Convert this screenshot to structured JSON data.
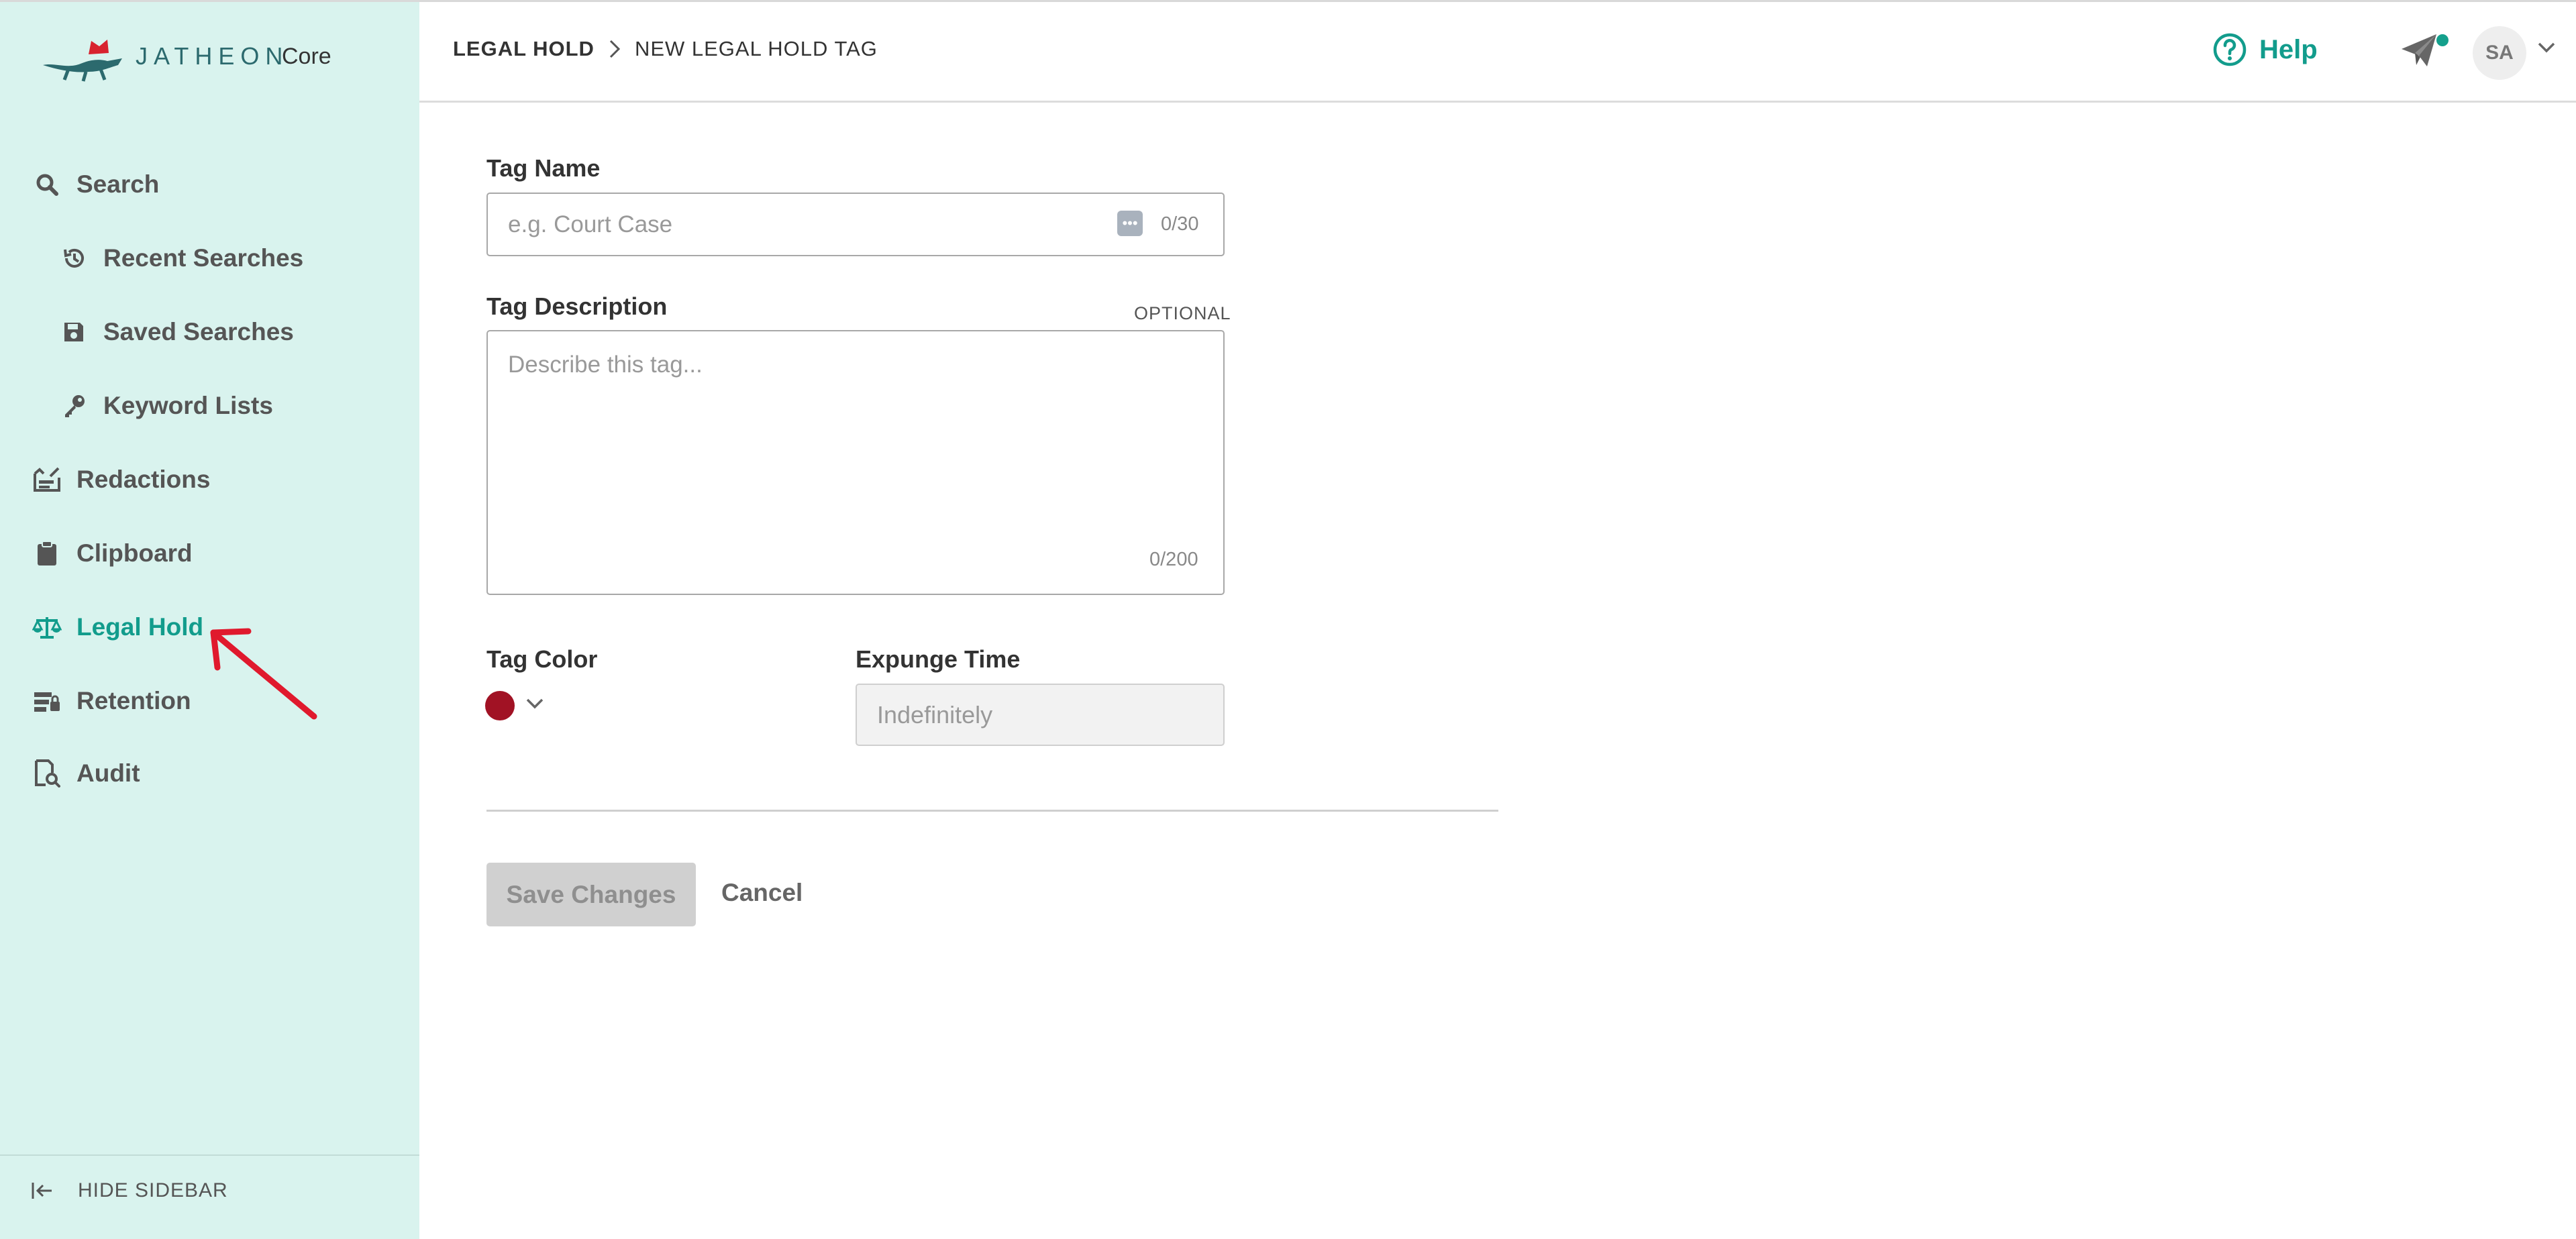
{
  "logo": {
    "brand": "JATHEON",
    "product": "Core"
  },
  "sidebar": {
    "items": [
      {
        "label": "Search",
        "icon": "search-icon"
      },
      {
        "label": "Recent Searches",
        "icon": "history-icon"
      },
      {
        "label": "Saved Searches",
        "icon": "save-icon"
      },
      {
        "label": "Keyword Lists",
        "icon": "key-icon"
      },
      {
        "label": "Redactions",
        "icon": "redaction-icon"
      },
      {
        "label": "Clipboard",
        "icon": "clipboard-icon"
      },
      {
        "label": "Legal Hold",
        "icon": "scale-icon",
        "active": true
      },
      {
        "label": "Retention",
        "icon": "retention-icon"
      },
      {
        "label": "Audit",
        "icon": "audit-icon"
      }
    ],
    "hide_label": "HIDE SIDEBAR"
  },
  "header": {
    "breadcrumb_root": "LEGAL HOLD",
    "breadcrumb_current": "NEW LEGAL HOLD TAG",
    "help_label": "Help",
    "avatar_initials": "SA"
  },
  "form": {
    "tag_name_label": "Tag Name",
    "tag_name_placeholder": "e.g. Court Case",
    "tag_name_counter": "0/30",
    "tag_description_label": "Tag Description",
    "optional_label": "OPTIONAL",
    "tag_description_placeholder": "Describe this tag...",
    "tag_description_counter": "0/200",
    "tag_color_label": "Tag Color",
    "expunge_label": "Expunge Time",
    "expunge_value": "Indefinitely",
    "save_label": "Save Changes",
    "cancel_label": "Cancel"
  },
  "colors": {
    "accent": "#129c8c",
    "sidebar_bg": "#d9f3ee",
    "tag_color": "#a11224",
    "annotation_arrow": "#e0192d"
  }
}
